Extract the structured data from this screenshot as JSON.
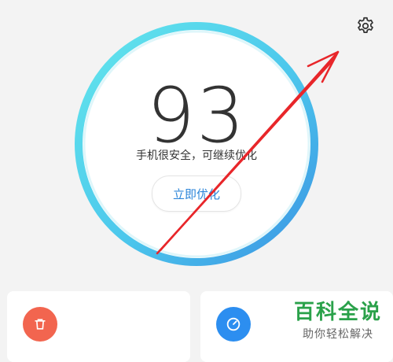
{
  "gauge": {
    "score": "93",
    "status_text": "手机很安全，可继续优化",
    "optimize_label": "立即优化"
  },
  "cards": {
    "left_icon": "trash-icon",
    "right_icon": "speedometer-icon"
  },
  "watermark": {
    "title": "百科全说",
    "subtitle": "助你轻松解决"
  },
  "icons": {
    "settings": "gear-icon"
  },
  "colors": {
    "ring_start": "#5ee4ec",
    "ring_end": "#3a9ae6",
    "accent_blue": "#2d86d9",
    "trash_red": "#f2654f",
    "speed_blue": "#2c8ef0",
    "arrow_red": "#e8262a",
    "watermark_green": "#2aa14a"
  }
}
